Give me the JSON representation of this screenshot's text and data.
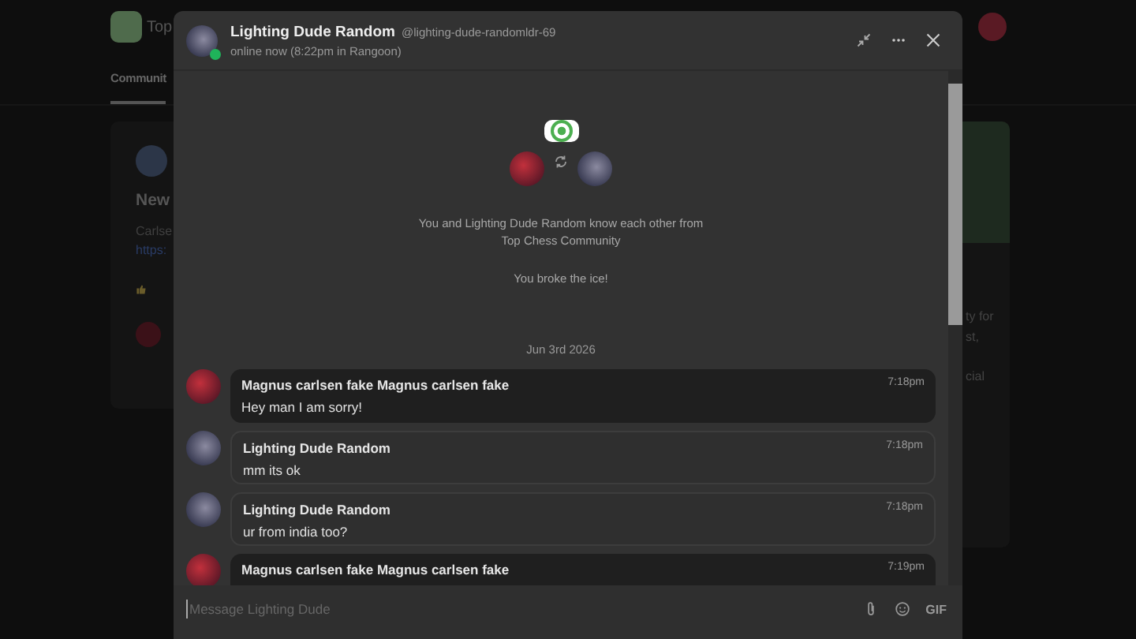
{
  "background": {
    "site_name": "Top",
    "tab": "Communit",
    "post_title": "New",
    "post_text": "Carlse",
    "post_link": "https:",
    "about_lines": [
      "ty for",
      "st,",
      "cial"
    ]
  },
  "chat": {
    "name": "Lighting Dude Random",
    "handle": "@lighting-dude-randomldr-69",
    "status": "online now (8:22pm in Rangoon)",
    "online": true,
    "intro": "You and Lighting Dude Random know each other from",
    "community": "Top Chess Community",
    "ice": "You broke the ice!",
    "date": "Jun 3rd 2026",
    "messages": [
      {
        "author": "Magnus carlsen fake Magnus carlsen fake",
        "time": "7:18pm",
        "text": "Hey man I am sorry!",
        "own": true
      },
      {
        "author": "Lighting Dude Random",
        "time": "7:18pm",
        "text": "mm its ok",
        "own": false
      },
      {
        "author": "Lighting Dude Random",
        "time": "7:18pm",
        "text": "ur from india too?",
        "own": false
      },
      {
        "author": "Magnus carlsen fake Magnus carlsen fake",
        "time": "7:19pm",
        "own": true
      }
    ],
    "input": {
      "placeholder": "Message Lighting Dude"
    },
    "gif": "GIF"
  }
}
